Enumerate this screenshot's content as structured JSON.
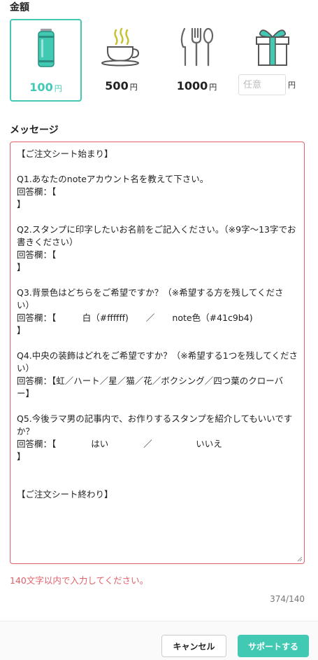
{
  "amount": {
    "title": "金額",
    "options": [
      {
        "value": "100",
        "unit": "円",
        "icon": "can-icon",
        "selected": true
      },
      {
        "value": "500",
        "unit": "円",
        "icon": "coffee-cup-icon",
        "selected": false
      },
      {
        "value": "1000",
        "unit": "円",
        "icon": "cutlery-icon",
        "selected": false
      }
    ],
    "custom": {
      "placeholder": "任意",
      "unit": "円",
      "icon": "gift-icon"
    }
  },
  "message": {
    "title": "メッセージ",
    "text": "【ご注文シート始まり】\n\nQ1.あなたのnoteアカウント名を教えて下さい。\n回答欄：【\n】\n\nQ2.スタンプに印字したいお名前をご記入ください。（※9字〜13字でお書きください）\n回答欄：【\n】\n\nQ3.背景色はどちらをご希望ですか？（※希望する方を残してください）\n回答欄：【　　　白（#ffffff)　　／　　note色（#41c9b4)\n】\n\nQ4.中央の装飾はどれをご希望ですか？（※希望する1つを残してください）\n回答欄：【虹／ハート／星／猫／花／ボクシング／四つ葉のクローバー】\n\nQ5.今後ラマ男の記事内で、お作りするスタンプを紹介してもいいですか？\n回答欄：【　　　　はい　　　　／　　　　　いいえ\n】\n\n\n【ご注文シート終わり】",
    "error": "140文字以内で入力してください。",
    "counter": "374/140"
  },
  "footer": {
    "cancel_label": "キャンセル",
    "support_label": "サポートする"
  },
  "colors": {
    "accent": "#41c9b4",
    "error": "#e0606a"
  }
}
